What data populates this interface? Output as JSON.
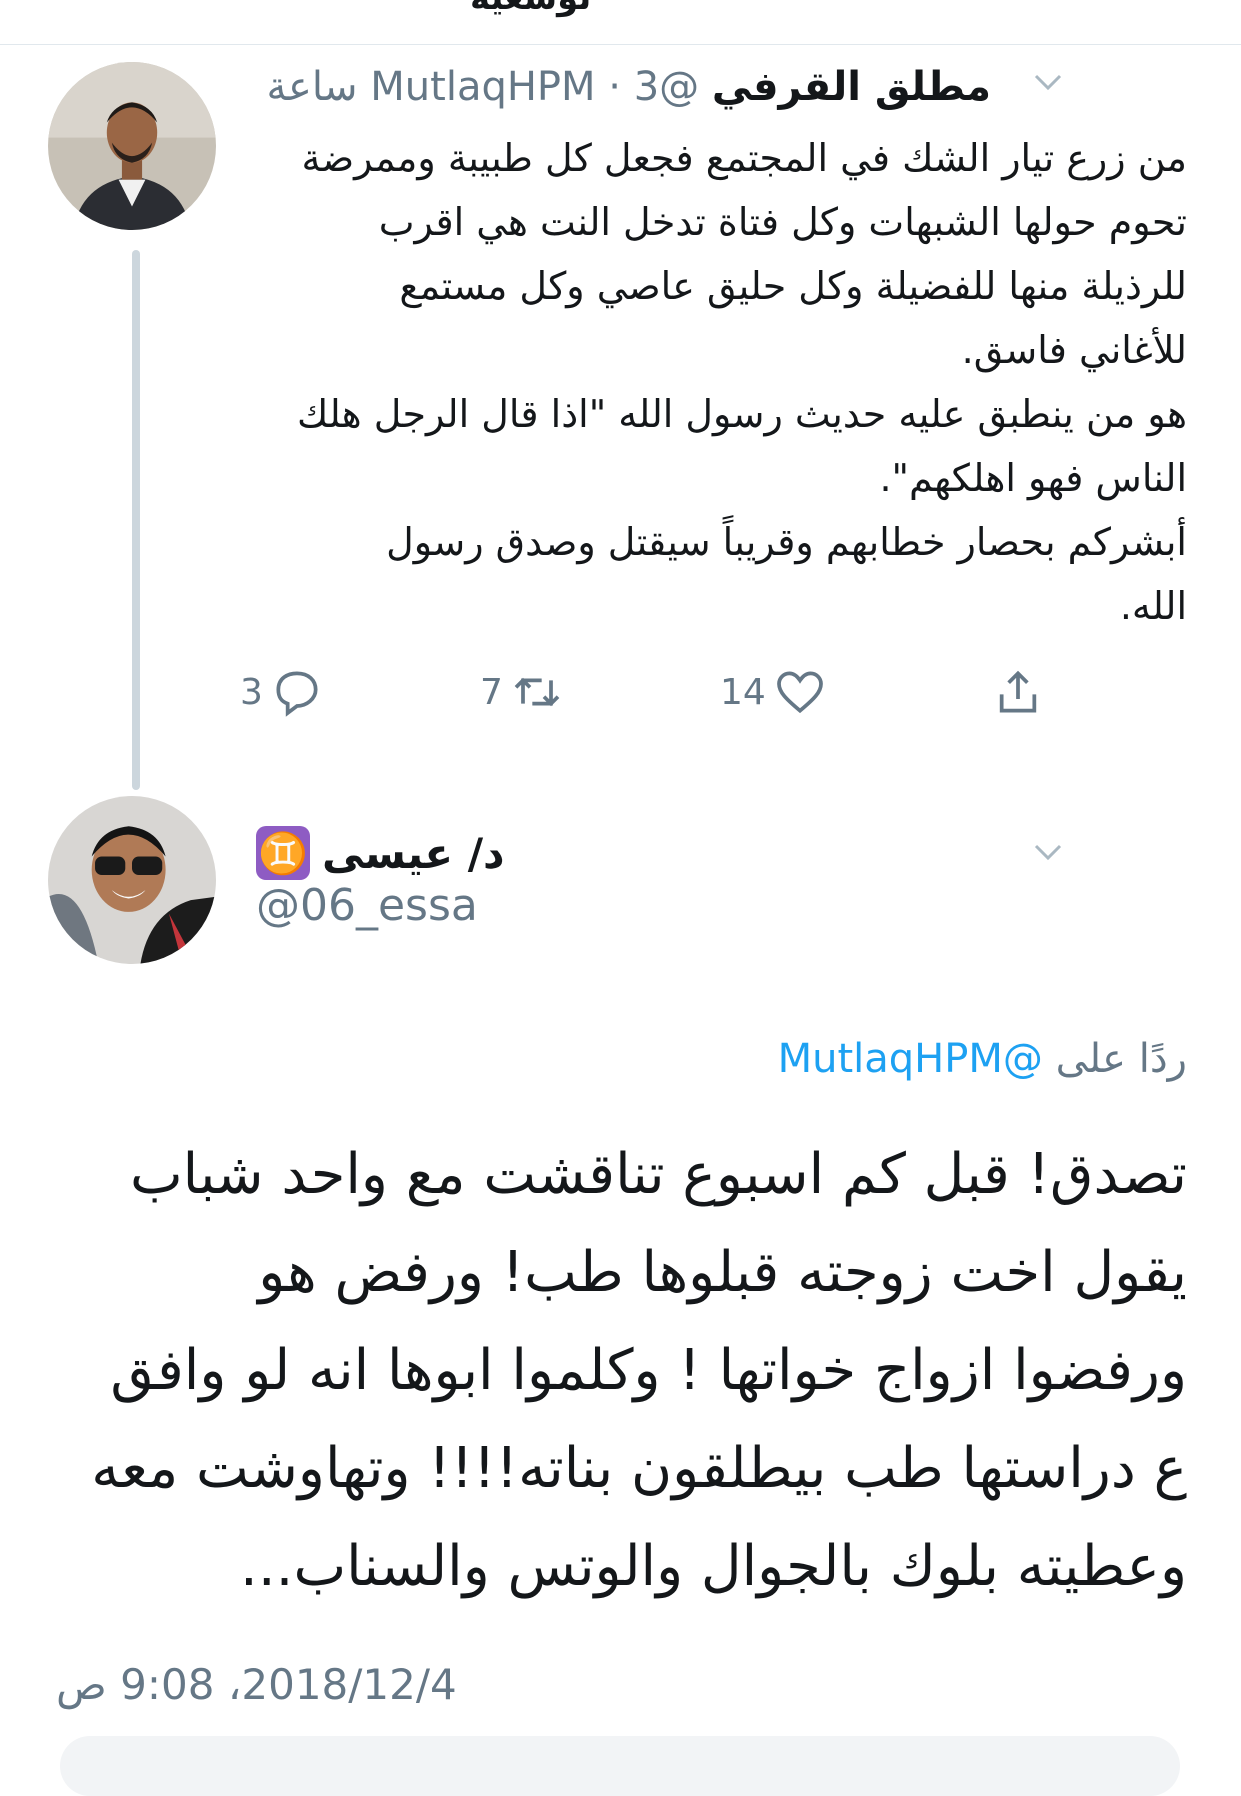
{
  "top_partial_text": "توسعيه",
  "tweet1": {
    "author_name": "مطلق القرفي",
    "handle": "@MutlaqHPM",
    "separator": "·",
    "time_ago": "3 ساعة",
    "body_lines": [
      "من زرع تيار الشك في المجتمع فجعل كل طبيبة وممرضة",
      "تحوم حولها الشبهات وكل فتاة تدخل النت هي اقرب",
      "للرذيلة منها للفضيلة وكل حليق عاصي وكل مستمع",
      "للأغاني فاسق.",
      "هو من ينطبق عليه حديث رسول الله \"اذا قال الرجل هلك",
      "الناس فهو اهلكهم\".",
      "أبشركم بحصار خطابهم وقريباً سيقتل وصدق رسول",
      "الله."
    ],
    "replies": "3",
    "retweets": "7",
    "likes": "14"
  },
  "tweet2": {
    "author_name": "د/ عيسى",
    "zodiac_badge": "♊",
    "handle": "@06_essa",
    "replying_label": "ردًا على",
    "replying_to": "@MutlaqHPM",
    "body_lines": [
      "تصدق! قبل كم اسبوع تناقشت مع واحد شباب",
      "يقول اخت زوجته قبلوها طب! ورفض هو",
      "ورفضوا ازواج خواتها ! وكلموا ابوها انه لو وافق",
      "ع دراستها طب بيطلقون بناته!!!! وتهاوشت معه",
      "وعطيته بلوك بالجوال والوتس والسناب..."
    ],
    "timestamp": "2018/12/4، 9:08 ص"
  },
  "icons": {
    "reply": "reply-icon",
    "retweet": "retweet-icon",
    "like": "heart-icon",
    "share": "share-icon",
    "more": "chevron-down-icon"
  },
  "colors": {
    "text": "#14171a",
    "secondary": "#657786",
    "link": "#1da1f2",
    "thread_line": "#ccd6dd",
    "badge": "#8e5cc3"
  }
}
